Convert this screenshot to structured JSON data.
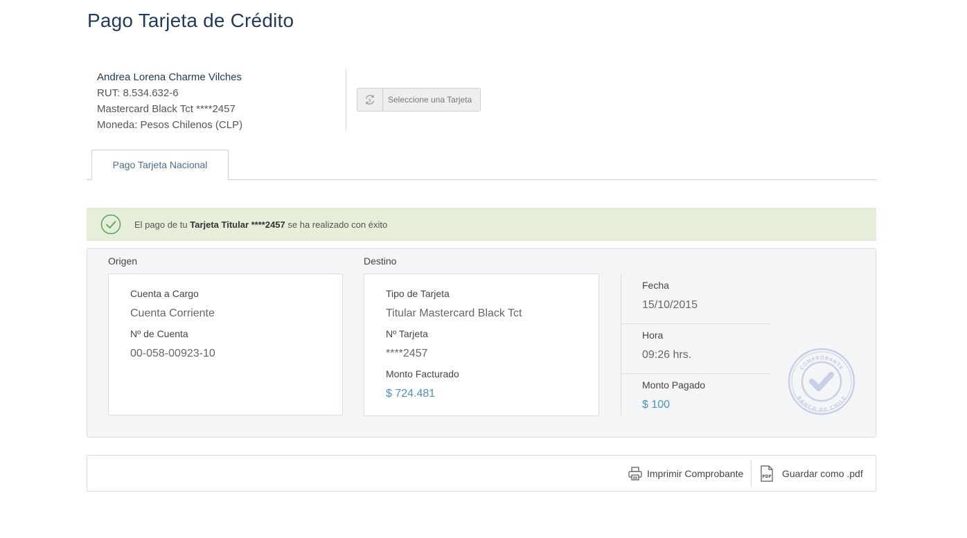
{
  "page": {
    "title": "Pago Tarjeta de Crédito"
  },
  "client": {
    "name": "Andrea Lorena Charme Vilches",
    "rut": "RUT: 8.534.632-6",
    "card": "Mastercard Black Tct ****2457",
    "currency": "Moneda: Pesos Chilenos (CLP)"
  },
  "select_card": {
    "label": "Seleccione una Tarjeta",
    "icon": "refresh-dollar-icon"
  },
  "tabs": [
    {
      "label": "Pago Tarjeta Nacional",
      "active": true
    }
  ],
  "alert": {
    "prefix": "El pago de tu ",
    "bold": "Tarjeta Titular ****2457",
    "suffix": " se ha realizado con éxito",
    "icon": "check-circle-icon",
    "color": "#e5eed9"
  },
  "origin": {
    "title": "Origen",
    "account_label": "Cuenta a Cargo",
    "account_value": "Cuenta Corriente",
    "number_label": "Nº de Cuenta",
    "number_value": "00-058-00923-10"
  },
  "destination": {
    "title": "Destino",
    "type_label": "Tipo de Tarjeta",
    "type_value": "Titular Mastercard Black Tct",
    "card_label": "Nº Tarjeta",
    "card_value": "****2457",
    "billed_label": "Monto Facturado",
    "billed_value": "$ 724.481"
  },
  "details": {
    "date_label": "Fecha",
    "date_value": "15/10/2015",
    "time_label": "Hora",
    "time_value": "09:26 hrs.",
    "paid_label": "Monto Pagado",
    "paid_value": "$ 100"
  },
  "stamp": {
    "top_text": "COMPROBANTE",
    "bottom_text": "BANCO DE CHILE",
    "icon": "approved-stamp-icon"
  },
  "actions": {
    "print_label": "Imprimir Comprobante",
    "pdf_label": "Guardar como .pdf",
    "pdf_icon_text": "PDF"
  },
  "colors": {
    "title": "#1f3a5f",
    "amount": "#4a90c8",
    "success_bg": "#e5eed9"
  }
}
